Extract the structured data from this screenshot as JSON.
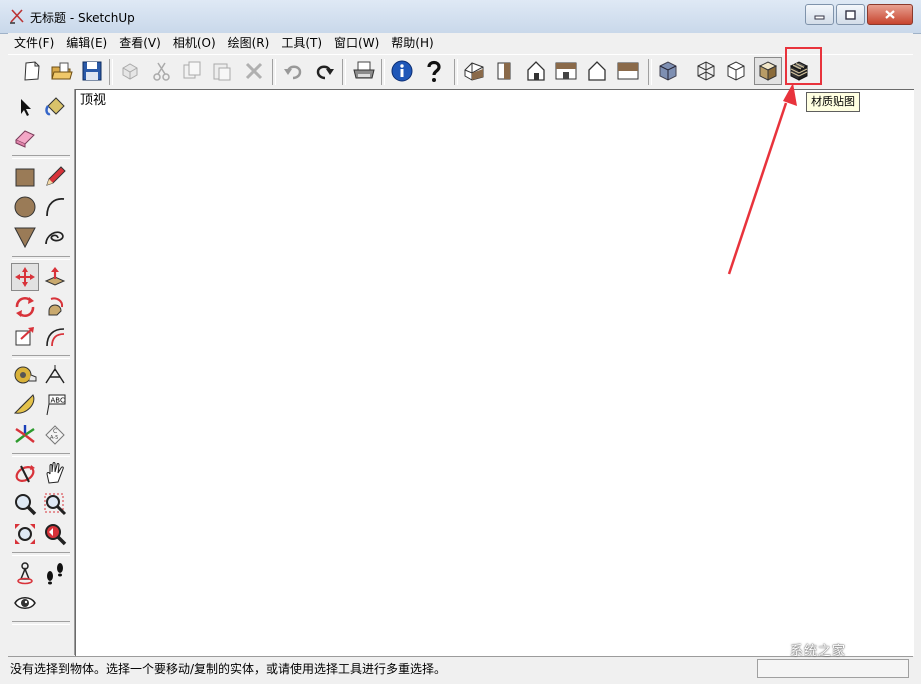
{
  "window": {
    "title": "无标题 - SketchUp"
  },
  "menubar": {
    "items": [
      "文件(F)",
      "编辑(E)",
      "查看(V)",
      "相机(O)",
      "绘图(R)",
      "工具(T)",
      "窗口(W)",
      "帮助(H)"
    ]
  },
  "toolbar": {
    "buttons": [
      "new",
      "open",
      "save",
      "make-component",
      "cut",
      "copy",
      "paste",
      "erase",
      "undo",
      "redo",
      "print",
      "model-info",
      "help",
      "iso-view",
      "top-view",
      "front-view",
      "right-view",
      "back-view",
      "left-view",
      "xray",
      "wireframe",
      "hidden-line",
      "shaded",
      "shaded-with-textures"
    ]
  },
  "canvas": {
    "view_label": "顶视"
  },
  "tooltip": {
    "text": "材质贴图"
  },
  "statusbar": {
    "message": "没有选择到物体。选择一个要移动/复制的实体，或请使用选择工具进行多重选择。"
  },
  "watermark": {
    "text": "系统之家"
  },
  "colors": {
    "highlight": "#e8333c",
    "titlebar": "#c9d8ea",
    "tooltip_bg": "#ffffe1"
  }
}
